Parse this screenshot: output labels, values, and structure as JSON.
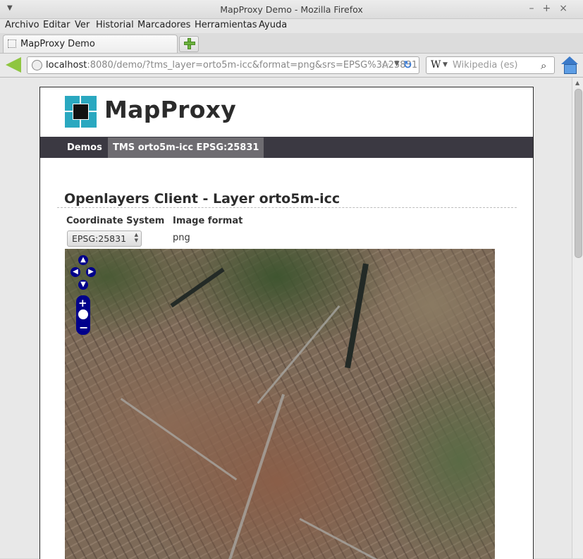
{
  "window": {
    "title": "MapProxy Demo - Mozilla Firefox",
    "controls": [
      "–",
      "+",
      "×"
    ]
  },
  "menubar": {
    "items": [
      "Archivo",
      "Editar",
      "Ver",
      "Historial",
      "Marcadores",
      "Herramientas",
      "Ayuda"
    ]
  },
  "tabs": [
    {
      "label": "MapProxy Demo",
      "favicon": "blank-page-icon"
    }
  ],
  "navbar": {
    "url_host": "localhost",
    "url_rest": ":8080/demo/?tms_layer=orto5m-icc&format=png&srs=EPSG%3A25831",
    "search_engine": "W",
    "search_placeholder": "Wikipedia (es)"
  },
  "site": {
    "logo_text": "MapProxy",
    "logo_color": "#2aa8c0",
    "nav": {
      "demos_label": "Demos",
      "active_label": "TMS orto5m-icc EPSG:25831"
    },
    "heading": "Openlayers Client - Layer orto5m-icc",
    "table": {
      "col_coordinate_system": "Coordinate System",
      "col_image_format": "Image format",
      "coordinate_system_value": "EPSG:25831",
      "image_format_value": "png"
    },
    "map": {
      "description": "aerial orthophoto map",
      "controls": [
        "pan-up",
        "pan-left",
        "pan-right",
        "pan-down",
        "zoom-in",
        "zoom-world",
        "zoom-out"
      ],
      "control_color": "#00008b"
    }
  }
}
